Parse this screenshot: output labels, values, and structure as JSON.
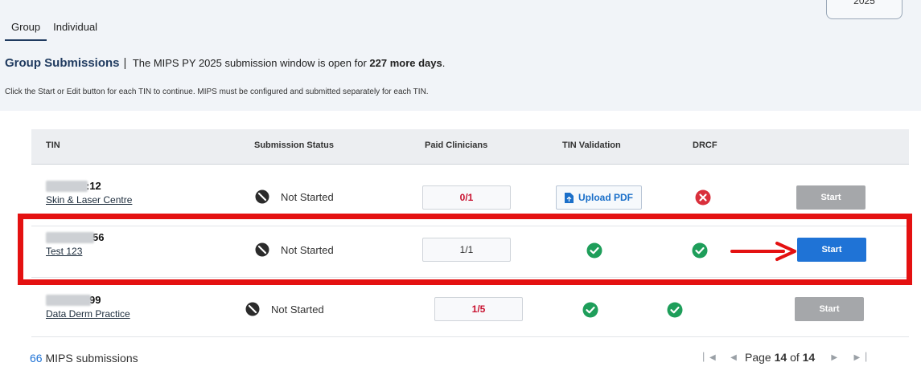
{
  "year_chip": "2025",
  "tabs": [
    {
      "label": "Group",
      "active": true
    },
    {
      "label": "Individual",
      "active": false
    }
  ],
  "headline": {
    "title": "Group Submissions",
    "separator": "|",
    "text_before": "The MIPS PY 2025 submission window is open for",
    "days": "227 more days",
    "text_after": "."
  },
  "instructions": "Click the Start or Edit button for each TIN to continue. MIPS must be configured and submitted separately for each TIN.",
  "table": {
    "headers": {
      "tin": "TIN",
      "status": "Submission Status",
      "clinicians": "Paid Clinicians",
      "validation": "TIN Validation",
      "drcf": "DRCF"
    },
    "rows": [
      {
        "tin_suffix": ":12",
        "name": "Skin & Laser Centre",
        "status": "Not Started",
        "clinicians": "0/1",
        "clinicians_alert": true,
        "validation": "Upload PDF",
        "validation_state": "upload",
        "drcf_state": "error",
        "action": "Start",
        "action_enabled": false
      },
      {
        "tin_suffix": "56",
        "name": "Test 123",
        "status": "Not Started",
        "clinicians": "1/1",
        "clinicians_alert": false,
        "validation_state": "ok",
        "drcf_state": "ok",
        "action": "Start",
        "action_enabled": true
      },
      {
        "tin_suffix": "99",
        "name": "Data Derm Practice",
        "status": "Not Started",
        "clinicians": "1/5",
        "clinicians_alert": true,
        "validation_state": "ok",
        "drcf_state": "ok",
        "action": "Start",
        "action_enabled": false
      }
    ]
  },
  "footer": {
    "count": "66",
    "count_label": "MIPS submissions",
    "page_label": "Page",
    "page_current": "14",
    "page_of": "of",
    "page_total": "14"
  },
  "colors": {
    "accent_blue": "#1f73d6",
    "alert_red": "#c8102e",
    "success_green": "#1e9e5a",
    "highlight_red": "#e41111"
  }
}
